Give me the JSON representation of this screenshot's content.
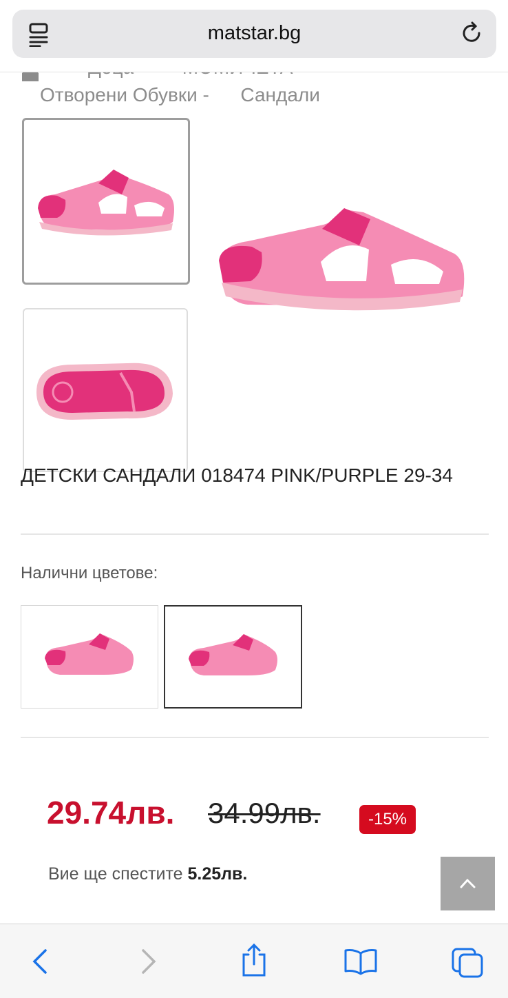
{
  "browser": {
    "domain": "matstar.bg"
  },
  "breadcrumb": {
    "row1_a": "Деца",
    "row1_b": "МОМИЧЕТА",
    "row2_a": "Отворени Обувки -",
    "row2_b": "Сандали"
  },
  "product": {
    "title": "ДЕТСКИ САНДАЛИ 018474 PINK/PURPLE 29-34"
  },
  "colors": {
    "label": "Налични цветове:"
  },
  "pricing": {
    "new_price": "29.74лв.",
    "old_price": "34.99лв.",
    "discount": "-15%",
    "savings_label": "Вие ще спестите",
    "savings_value": "5.25лв."
  },
  "theme": {
    "accent": "#c8102e",
    "badge": "#d50b1f",
    "link": "#1a73e8",
    "shoe_light": "#f58cb4",
    "shoe_dark": "#e2317a"
  }
}
